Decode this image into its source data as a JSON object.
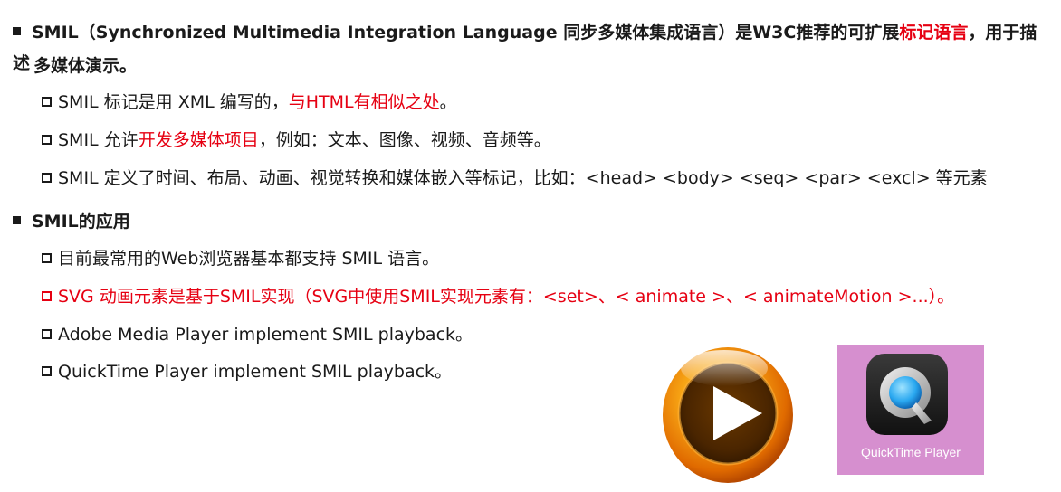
{
  "section1": {
    "heading_prefix": "SMIL（Synchronized Multimedia Integration Language 同步多媒体集成语言）是W3C推荐的可扩展",
    "heading_highlight": "标记语言",
    "heading_suffix": "，用于描述",
    "heading_line2": "多媒体演示。",
    "items": [
      {
        "prefix": "SMIL 标记是用 XML 编写的，",
        "highlight": "与HTML有相似之处",
        "suffix": "。"
      },
      {
        "prefix": "SMIL 允许",
        "highlight": "开发多媒体项目",
        "suffix": "，例如：文本、图像、视频、音频等。"
      },
      {
        "text": "SMIL 定义了时间、布局、动画、视觉转换和媒体嵌入等标记，比如：<head> <body> <seq>  <par>  <excl> 等元素"
      }
    ]
  },
  "section2": {
    "heading": "SMIL的应用",
    "items": [
      {
        "text": "目前最常用的Web浏览器基本都支持 SMIL 语言。"
      },
      {
        "text": "SVG 动画元素是基于SMIL实现（SVG中使用SMIL实现元素有：<set>、< animate >、< animateMotion >...）。"
      },
      {
        "text": "Adobe Media Player implement SMIL playback。"
      },
      {
        "text": "QuickTime Player implement SMIL playback。"
      }
    ]
  },
  "images": {
    "quicktime_label": "QuickTime Player"
  },
  "colors": {
    "highlight": "#e60012",
    "quicktime_tile": "#d68fcf"
  }
}
